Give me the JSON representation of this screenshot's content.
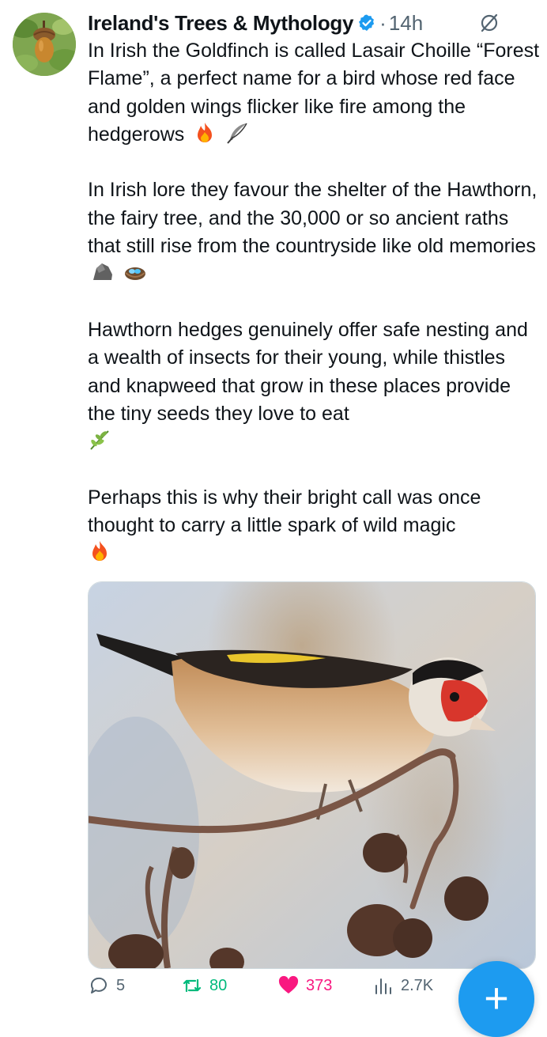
{
  "tweet": {
    "author_name": "Ireland's Trees & Mythology",
    "separator": "·",
    "timestamp": "14h",
    "more_label": "···",
    "paragraphs": [
      {
        "text": "In Irish the Goldfinch is called Lasair Choille “Forest Flame”, a perfect name for a bird whose red face and golden wings flicker like fire among the hedgerows",
        "emojis": [
          "fire-emoji",
          "feather-emoji"
        ]
      },
      {
        "text": "In Irish lore they favour the shelter of the Hawthorn, the fairy tree, and the 30,000 or so ancient raths that still rise from the countryside like old memories",
        "emojis": [
          "rock-emoji",
          "nest-with-eggs-emoji"
        ]
      },
      {
        "text": "Hawthorn hedges genuinely offer safe nesting and a wealth of insects for their young, while thistles and knapweed that grow in these places provide the tiny seeds they love to eat",
        "emojis": [
          "herb-emoji"
        ]
      },
      {
        "text": "Perhaps this is why their bright call was once thought to carry a little spark of wild magic",
        "emojis": [
          "fire-emoji"
        ]
      }
    ]
  },
  "actions": {
    "replies": "5",
    "retweets": "80",
    "likes": "373",
    "views": "2.7K"
  },
  "fab_label": "+",
  "colors": {
    "verified": "#1d9bf0",
    "retweet": "#00ba7c",
    "like": "#f91880",
    "secondary_text": "#536471",
    "fab": "#1d9bf0"
  }
}
